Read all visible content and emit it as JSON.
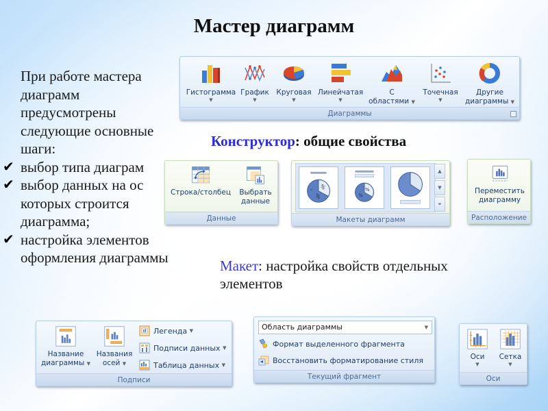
{
  "slide": {
    "title": "Мастер диаграмм",
    "intro_lines": [
      "При работе мастера",
      "диаграмм",
      "предусмотрены",
      "следующие основные",
      "шаги:"
    ],
    "steps": [
      {
        "lines": [
          "выбор типа диаграм"
        ]
      },
      {
        "lines": [
          "выбор данных на ос",
          "которых строится",
          "диаграмма;"
        ]
      },
      {
        "lines": [
          "настройка элементов",
          "оформления диаграммы"
        ]
      }
    ],
    "check_glyph": "✔",
    "constructor_heading": {
      "accent": "Конструктор",
      "rest": ": общие свойства"
    },
    "layout_heading": {
      "accent": "Макет",
      "rest": ": настройка свойств отдельных элементов"
    }
  },
  "colors": {
    "accent_blue": "#2b2bd8",
    "ribbon_text": "#1f3d6b",
    "group_label_text": "#4a6a96"
  },
  "charts_group": {
    "label": "Диаграммы",
    "buttons": [
      {
        "id": "histogram",
        "label": "Гистограмма",
        "icon": "column-chart-icon",
        "dropdown": true
      },
      {
        "id": "line",
        "label": "График",
        "icon": "line-chart-icon",
        "dropdown": true
      },
      {
        "id": "pie",
        "label": "Круговая",
        "icon": "pie-chart-icon",
        "dropdown": true
      },
      {
        "id": "bar",
        "label": "Линейчатая",
        "icon": "bar-chart-icon",
        "dropdown": true
      },
      {
        "id": "area",
        "label_line1": "С",
        "label_line2": "областями",
        "icon": "area-chart-icon",
        "dropdown": true
      },
      {
        "id": "scatter",
        "label": "Точечная",
        "icon": "scatter-chart-icon",
        "dropdown": true
      },
      {
        "id": "other",
        "label_line1": "Другие",
        "label_line2": "диаграммы",
        "icon": "doughnut-chart-icon",
        "dropdown": true
      }
    ],
    "dropdown_glyph": "▼"
  },
  "data_group": {
    "label": "Данные",
    "buttons": [
      {
        "id": "switch",
        "label": "Строка/столбец",
        "icon": "switch-row-column-icon"
      },
      {
        "id": "select",
        "label_line1": "Выбрать",
        "label_line2": "данные",
        "icon": "select-data-icon"
      }
    ]
  },
  "layouts_group": {
    "label": "Макеты диаграмм",
    "items": [
      "layout-1",
      "layout-2",
      "layout-3"
    ],
    "scroll_up": "▲",
    "scroll_down": "▼",
    "more": "⏷"
  },
  "location_group": {
    "label": "Расположение",
    "button": {
      "label_line1": "Переместить",
      "label_line2": "диаграмму",
      "icon": "move-chart-icon"
    }
  },
  "labels_group": {
    "label": "Подписи",
    "large_buttons": [
      {
        "id": "chart-title",
        "label_line1": "Название",
        "label_line2": "диаграммы",
        "icon": "chart-title-icon"
      },
      {
        "id": "axis-titles",
        "label_line1": "Названия",
        "label_line2": "осей",
        "icon": "axis-titles-icon"
      }
    ],
    "small_buttons": [
      {
        "id": "legend",
        "label": "Легенда",
        "icon": "legend-icon"
      },
      {
        "id": "data-labels",
        "label": "Подписи данных",
        "icon": "data-labels-icon"
      },
      {
        "id": "data-table",
        "label": "Таблица данных",
        "icon": "data-table-icon"
      }
    ]
  },
  "current_selection_group": {
    "label": "Текущий фрагмент",
    "dropdown_value": "Область диаграммы",
    "buttons": [
      {
        "id": "format-selection",
        "label": "Формат выделенного фрагмента",
        "icon": "format-selection-icon"
      },
      {
        "id": "reset-style",
        "label": "Восстановить форматирование стиля",
        "icon": "reset-style-icon"
      }
    ]
  },
  "axes_group": {
    "label": "Оси",
    "buttons": [
      {
        "id": "axes",
        "label": "Оси",
        "icon": "axes-icon"
      },
      {
        "id": "gridlines",
        "label": "Сетка",
        "icon": "gridlines-icon"
      }
    ]
  }
}
